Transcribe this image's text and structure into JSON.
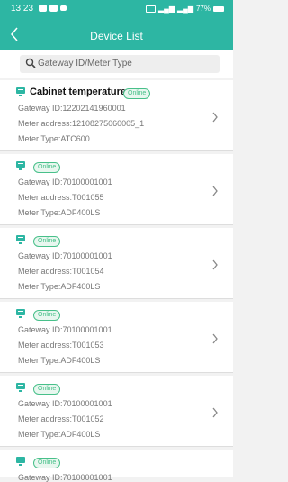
{
  "status": {
    "time": "13:23",
    "battery": "77%"
  },
  "header": {
    "title": "Device List"
  },
  "search": {
    "placeholder": "Gateway ID/Meter Type"
  },
  "devices": [
    {
      "name": "Cabinet temperature",
      "status": "Online",
      "gateway": "Gateway ID:12202141960001",
      "meter": "Meter address:12108275060005_1",
      "type": "Meter Type:ATC600"
    },
    {
      "name": "",
      "status": "Online",
      "gateway": "Gateway ID:70100001001",
      "meter": "Meter address:T001055",
      "type": "Meter Type:ADF400LS"
    },
    {
      "name": "",
      "status": "Online",
      "gateway": "Gateway ID:70100001001",
      "meter": "Meter address:T001054",
      "type": "Meter Type:ADF400LS"
    },
    {
      "name": "",
      "status": "Online",
      "gateway": "Gateway ID:70100001001",
      "meter": "Meter address:T001053",
      "type": "Meter Type:ADF400LS"
    },
    {
      "name": "",
      "status": "Online",
      "gateway": "Gateway ID:70100001001",
      "meter": "Meter address:T001052",
      "type": "Meter Type:ADF400LS"
    },
    {
      "name": "",
      "status": "Online",
      "gateway": "Gateway ID:70100001001"
    }
  ],
  "colors": {
    "header": "#2db6a3",
    "online": "#48c08a",
    "device_icon": "#2db6a3"
  }
}
